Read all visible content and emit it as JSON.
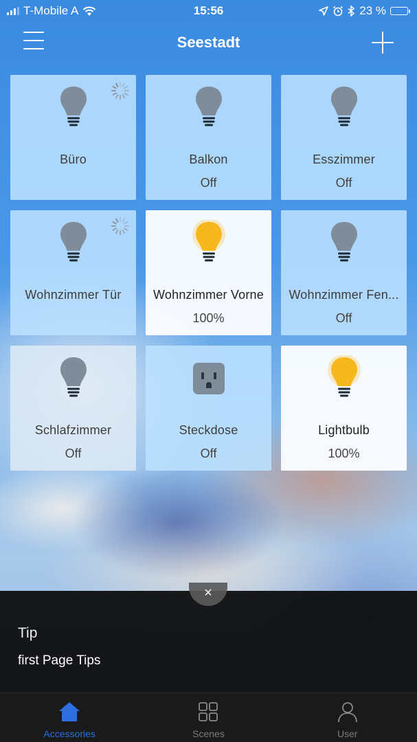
{
  "status_bar": {
    "carrier": "T-Mobile A",
    "time": "15:56",
    "battery_percent": "23 %",
    "battery_level": 0.23
  },
  "nav": {
    "title": "Seestadt"
  },
  "tiles": [
    {
      "name": "Büro",
      "status": "",
      "icon": "lightbulb-icon",
      "state": "loading"
    },
    {
      "name": "Balkon",
      "status": "Off",
      "icon": "lightbulb-icon",
      "state": "off"
    },
    {
      "name": "Esszimmer",
      "status": "Off",
      "icon": "lightbulb-icon",
      "state": "off"
    },
    {
      "name": "Wohnzimmer Tür",
      "status": "",
      "icon": "lightbulb-icon",
      "state": "loading"
    },
    {
      "name": "Wohnzimmer Vorne",
      "status": "100%",
      "icon": "lightbulb-icon",
      "state": "on"
    },
    {
      "name": "Wohnzimmer Fen...",
      "status": "Off",
      "icon": "lightbulb-icon",
      "state": "off"
    },
    {
      "name": "Schlafzimmer",
      "status": "Off",
      "icon": "lightbulb-icon",
      "state": "off"
    },
    {
      "name": "Steckdose",
      "status": "Off",
      "icon": "outlet-icon",
      "state": "off"
    },
    {
      "name": "Lightbulb",
      "status": "100%",
      "icon": "lightbulb-icon",
      "state": "on"
    }
  ],
  "tip": {
    "title": "Tip",
    "text": "first Page Tips",
    "close_label": "×"
  },
  "tabs": [
    {
      "label": "Accessories",
      "icon": "home-icon",
      "active": true
    },
    {
      "label": "Scenes",
      "icon": "grid-icon",
      "active": false
    },
    {
      "label": "User",
      "icon": "user-icon",
      "active": false
    }
  ],
  "colors": {
    "bulb_off": "#7f8c9a",
    "bulb_on": "#f6b81c",
    "accent": "#2d6fe0",
    "tile_bg": "#bee2ff"
  }
}
